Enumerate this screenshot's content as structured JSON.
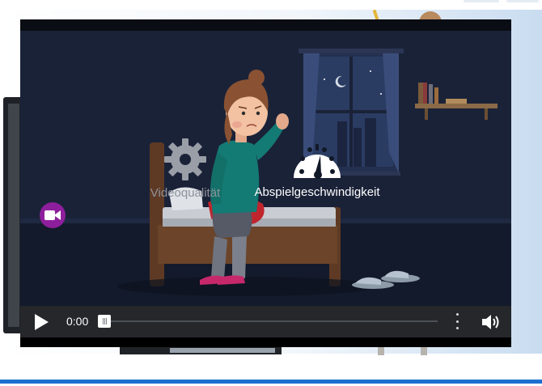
{
  "player": {
    "settings": {
      "quality_label": "Videoqualität",
      "speed_label": "Abspielgeschwindigkeit"
    },
    "controls": {
      "current_time": "0:00",
      "progress": 0
    },
    "icons": {
      "play": "play-icon",
      "camera": "video-camera-icon",
      "gear": "gear-icon",
      "speed": "speedometer-icon",
      "menu": "vertical-dots-icon",
      "volume": "speaker-icon"
    }
  },
  "colors": {
    "scene_background": "#1a2238",
    "control_bar": "#25272b",
    "camera_button": "#8e1f9c",
    "page_accent_line": "#1e6fd0"
  }
}
